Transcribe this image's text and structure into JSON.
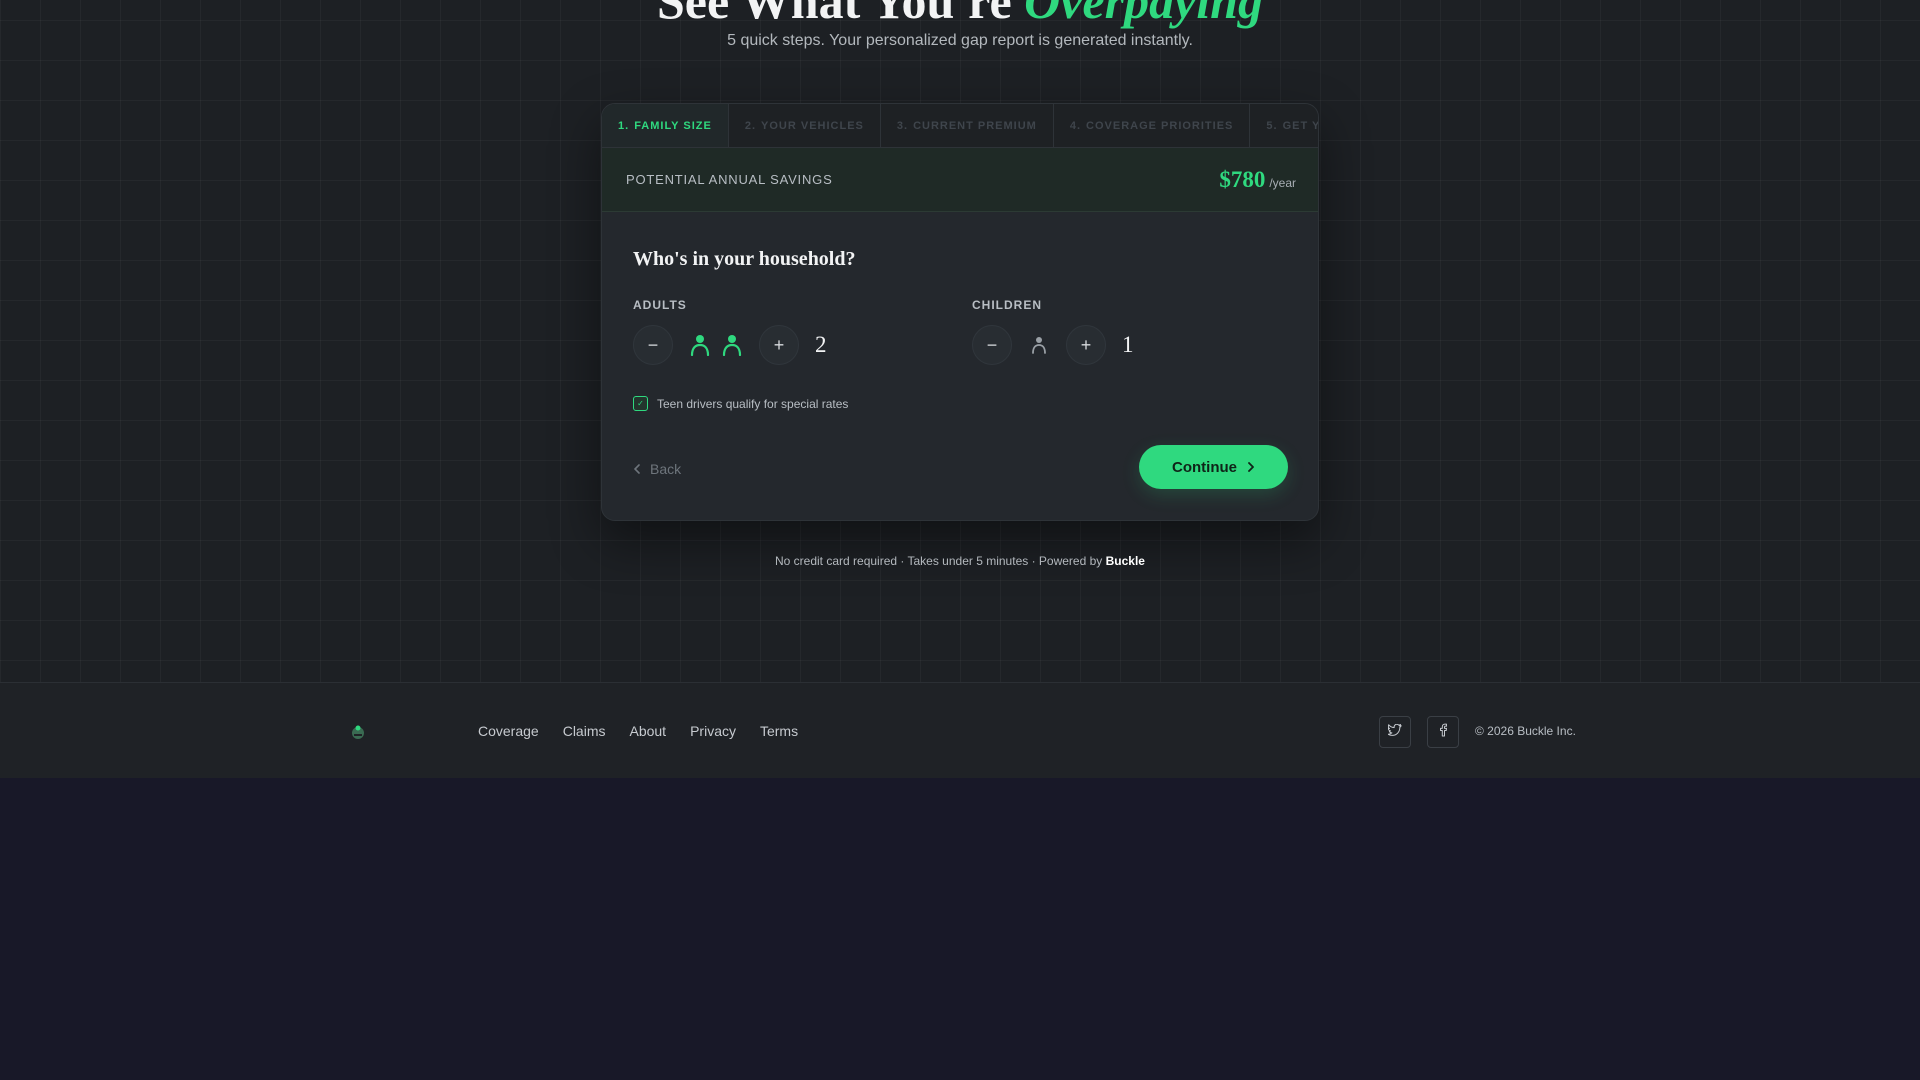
{
  "hero": {
    "title_main": "See What You're",
    "title_accent": "Overpaying",
    "subtitle": "5 quick steps. Your personalized gap report is generated instantly."
  },
  "steps": [
    {
      "num": "1.",
      "label": "Family Size"
    },
    {
      "num": "2.",
      "label": "Your Vehicles"
    },
    {
      "num": "3.",
      "label": "Current Premium"
    },
    {
      "num": "4.",
      "label": "Coverage Priorities"
    },
    {
      "num": "5.",
      "label": "Get Your"
    }
  ],
  "savings": {
    "label": "POTENTIAL ANNUAL SAVINGS",
    "value": "$780",
    "unit": "/year"
  },
  "question": "Who's in your household?",
  "adults": {
    "label": "ADULTS",
    "count": "2",
    "minus": "−",
    "plus": "+"
  },
  "children": {
    "label": "CHILDREN",
    "count": "1",
    "minus": "−",
    "plus": "+"
  },
  "teen_drivers": {
    "label": "Teen drivers qualify for special rates",
    "checked": true
  },
  "nav": {
    "back": "Back",
    "continue": "Continue"
  },
  "footnote": {
    "text": "No credit card required · Takes under 5 minutes · Powered by",
    "brand": "Buckle"
  },
  "footer": {
    "links": [
      "Coverage",
      "Claims",
      "About",
      "Privacy",
      "Terms"
    ],
    "copyright": "© 2026 Buckle Inc.",
    "social_icons": [
      "twitter-icon",
      "facebook-icon"
    ]
  },
  "colors": {
    "accent": "#2fd97f",
    "background": "#1d2024",
    "card": "#24282d",
    "footer": "#1f2226",
    "page_bottom": "#181828"
  }
}
